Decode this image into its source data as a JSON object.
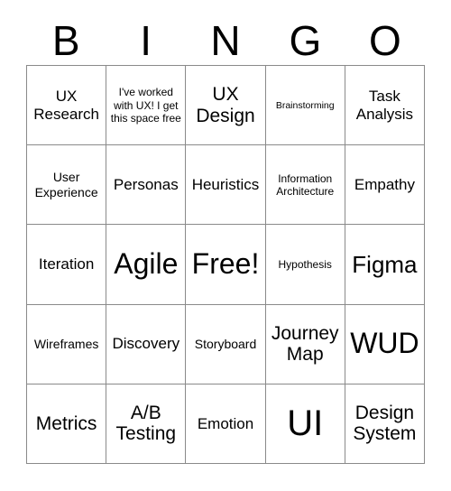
{
  "card": {
    "title": "BINGO",
    "header_letters": [
      "B",
      "I",
      "N",
      "G",
      "O"
    ],
    "border_color": "#8a8a8a",
    "cell_background": "#ffffff",
    "text_color": "#000000",
    "columns": 5,
    "rows": 5
  },
  "grid": {
    "rows": [
      {
        "cells": [
          {
            "text": "UX Research",
            "size": "m"
          },
          {
            "text": "I've worked with UX! I get this space free",
            "size": "xs"
          },
          {
            "text": "UX Design",
            "size": "l"
          },
          {
            "text": "Brainstorming",
            "size": "xxs"
          },
          {
            "text": "Task Analysis",
            "size": "m"
          }
        ]
      },
      {
        "cells": [
          {
            "text": "User Experience",
            "size": "s"
          },
          {
            "text": "Personas",
            "size": "m"
          },
          {
            "text": "Heuristics",
            "size": "m"
          },
          {
            "text": "Information Architecture",
            "size": "xs"
          },
          {
            "text": "Empathy",
            "size": "m"
          }
        ]
      },
      {
        "cells": [
          {
            "text": "Iteration",
            "size": "m"
          },
          {
            "text": "Agile",
            "size": "xxl"
          },
          {
            "text": "Free!",
            "size": "xxl"
          },
          {
            "text": "Hypothesis",
            "size": "xs"
          },
          {
            "text": "Figma",
            "size": "xl"
          }
        ]
      },
      {
        "cells": [
          {
            "text": "Wireframes",
            "size": "s"
          },
          {
            "text": "Discovery",
            "size": "m"
          },
          {
            "text": "Storyboard",
            "size": "s"
          },
          {
            "text": "Journey Map",
            "size": "l"
          },
          {
            "text": "WUD",
            "size": "xxl"
          }
        ]
      },
      {
        "cells": [
          {
            "text": "Metrics",
            "size": "l"
          },
          {
            "text": "A/B Testing",
            "size": "l"
          },
          {
            "text": "Emotion",
            "size": "m"
          },
          {
            "text": "UI",
            "size": "huge"
          },
          {
            "text": "Design System",
            "size": "l"
          }
        ]
      }
    ]
  }
}
